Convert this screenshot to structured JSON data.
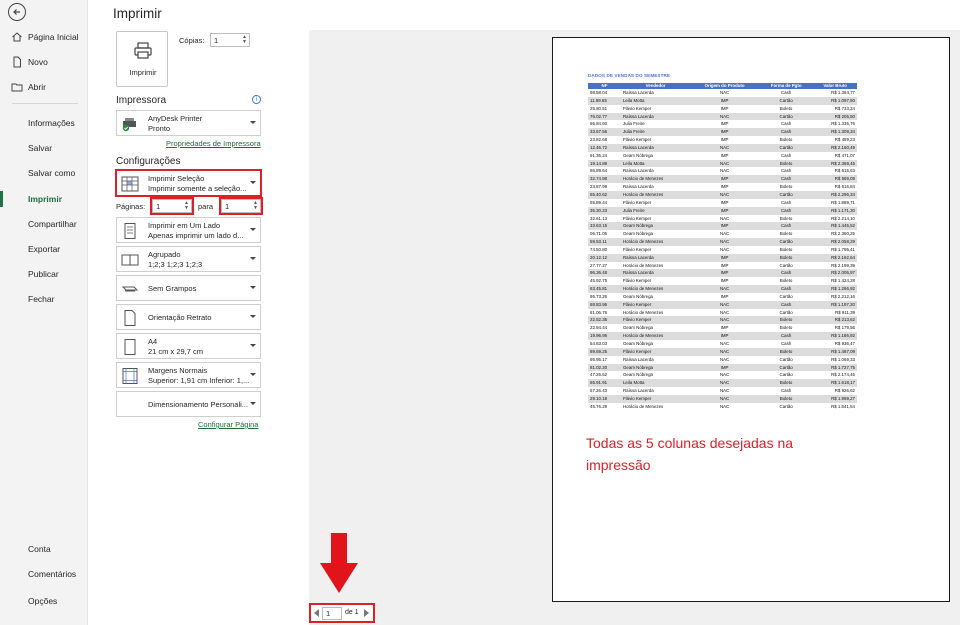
{
  "nav": {
    "items_top": [
      "Página Inicial",
      "Novo",
      "Abrir"
    ],
    "items_mid": [
      "Informações",
      "Salvar",
      "Salvar como",
      "Imprimir",
      "Compartilhar",
      "Exportar",
      "Publicar",
      "Fechar"
    ],
    "items_bottom": [
      "Conta",
      "Comentários",
      "Opções"
    ],
    "active": "Imprimir"
  },
  "print": {
    "title": "Imprimir",
    "print_button": "Imprimir",
    "copies_label": "Cópias:",
    "copies_value": "1"
  },
  "printer": {
    "section": "Impressora",
    "name": "AnyDesk Printer",
    "status": "Pronto",
    "properties_link": "Propriedades de Impressora"
  },
  "settings": {
    "section": "Configurações",
    "what": {
      "l1": "Imprimir Seleção",
      "l2": "Imprimir somente a seleção..."
    },
    "pages_label": "Páginas:",
    "pages_from": "1",
    "pages_to_label": "para",
    "pages_to": "1",
    "sides": {
      "l1": "Imprimir em Um Lado",
      "l2": "Apenas imprimir um lado d..."
    },
    "collate": {
      "l1": "Agrupado",
      "l2": "1;2;3    1;2;3    1;2;3"
    },
    "staple": "Sem Grampos",
    "orientation": "Orientação Retrato",
    "paper": {
      "l1": "A4",
      "l2": "21 cm x 29,7 cm"
    },
    "margins": {
      "l1": "Margens Normais",
      "l2": "Superior: 1,91 cm Inferior: 1,..."
    },
    "scaling": "Dimensionamento Personali...",
    "page_setup_link": "Configurar Página"
  },
  "preview": {
    "sheet_title": "DADOS DE VENDAS DO SEMESTRE",
    "columns": [
      "NF",
      "Vendedor",
      "Origem do Produto",
      "Forma de Pgto",
      "Valor Bruto"
    ],
    "rows": [
      [
        "98.58.04",
        "Raíssa Lacerda",
        "NAC",
        "Cash",
        "R$ 1.364,77"
      ],
      [
        "11.99.65",
        "Leila Motta",
        "IMP",
        "Cartão",
        "R$ 1.097,50"
      ],
      [
        "25.80.51",
        "Flávio Kemper",
        "IMP",
        "Boleto",
        "R$ 733,24"
      ],
      [
        "76.02.77",
        "Raíssa Lacerda",
        "NAC",
        "Cartão",
        "R$ 205,50"
      ],
      [
        "95.84.60",
        "Julia Freire",
        "IMP",
        "Cash",
        "R$ 1.335,76"
      ],
      [
        "33.67.56",
        "Julia Freire",
        "IMP",
        "Cash",
        "R$ 1.309,34"
      ],
      [
        "23.82.68",
        "Flávio Kemper",
        "IMP",
        "Boleto",
        "R$ 459,23"
      ],
      [
        "12.46.72",
        "Raíssa Lacerda",
        "NAC",
        "Cartão",
        "R$ 2.160,49"
      ],
      [
        "91.35.24",
        "Geam Nóbrega",
        "IMP",
        "Cash",
        "R$ 471,07"
      ],
      [
        "19.14.89",
        "Leila Motta",
        "NAC",
        "Boleto",
        "R$ 2.369,45"
      ],
      [
        "86.89.64",
        "Raíssa Lacerda",
        "NAC",
        "Cash",
        "R$ 615,63"
      ],
      [
        "32.74.98",
        "Horácio de Menezes",
        "IMP",
        "Cash",
        "R$ 569,09"
      ],
      [
        "23.87.99",
        "Raíssa Lacerda",
        "IMP",
        "Boleto",
        "R$ 616,84"
      ],
      [
        "65.40.62",
        "Horácio de Menezes",
        "NAC",
        "Cartão",
        "R$ 2.296,34"
      ],
      [
        "55.89.44",
        "Flávio Kemper",
        "IMP",
        "Cash",
        "R$ 1.889,71"
      ],
      [
        "35.30.23",
        "Julia Freire",
        "IMP",
        "Cash",
        "R$ 1.171,30"
      ],
      [
        "32.61.13",
        "Flávio Kemper",
        "NAC",
        "Boleto",
        "R$ 2.214,10"
      ],
      [
        "33.63.15",
        "Geam Nóbrega",
        "IMP",
        "Cash",
        "R$ 1.445,52"
      ],
      [
        "06.71.05",
        "Geam Nóbrega",
        "NAC",
        "Boleto",
        "R$ 2.360,25"
      ],
      [
        "59.53.11",
        "Horácio de Menezes",
        "NAC",
        "Cartão",
        "R$ 2.058,29"
      ],
      [
        "74.50.80",
        "Flávio Kemper",
        "NAC",
        "Boleto",
        "R$ 1.795,41"
      ],
      [
        "20.12.12",
        "Raíssa Lacerda",
        "IMP",
        "Boleto",
        "R$ 2.162,64"
      ],
      [
        "27.77.27",
        "Horácio de Menezes",
        "IMP",
        "Cartão",
        "R$ 2.199,39"
      ],
      [
        "96.36.48",
        "Raíssa Lacerda",
        "IMP",
        "Cash",
        "R$ 2.006,97"
      ],
      [
        "45.92.75",
        "Flávio Kemper",
        "IMP",
        "Boleto",
        "R$ 1.424,28"
      ],
      [
        "63.45.81",
        "Horácio de Menezes",
        "NAC",
        "Cash",
        "R$ 1.266,92"
      ],
      [
        "95.73.26",
        "Geam Nóbrega",
        "IMP",
        "Cartão",
        "R$ 2.212,16"
      ],
      [
        "88.83.96",
        "Flávio Kemper",
        "NAC",
        "Cash",
        "R$ 1.197,20"
      ],
      [
        "81.06.76",
        "Horácio de Menezes",
        "NAC",
        "Cartão",
        "R$ 911,39"
      ],
      [
        "22.52.35",
        "Flávio Kemper",
        "NAC",
        "Boleto",
        "R$ 213,62"
      ],
      [
        "22.94.44",
        "Geam Nóbrega",
        "IMP",
        "Boleto",
        "R$ 179,56"
      ],
      [
        "19.96.95",
        "Horácio de Menezes",
        "IMP",
        "Cash",
        "R$ 1.186,92"
      ],
      [
        "54.83.03",
        "Geam Nóbrega",
        "NAC",
        "Cash",
        "R$ 936,47"
      ],
      [
        "89.69.25",
        "Flávio Kemper",
        "NAC",
        "Boleto",
        "R$ 1.467,09"
      ],
      [
        "95.95.17",
        "Raíssa Lacerda",
        "NAC",
        "Cartão",
        "R$ 1.069,33"
      ],
      [
        "81.02.20",
        "Geam Nóbrega",
        "IMP",
        "Cartão",
        "R$ 1.727,75"
      ],
      [
        "47.26.52",
        "Geam Nóbrega",
        "NAC",
        "Cartão",
        "R$ 2.174,45"
      ],
      [
        "65.91.91",
        "Leila Motta",
        "NAC",
        "Boleto",
        "R$ 1.618,17"
      ],
      [
        "57.26.43",
        "Raíssa Lacerda",
        "NAC",
        "Cash",
        "R$ 926,62"
      ],
      [
        "29.10.18",
        "Flávio Kemper",
        "NAC",
        "Boleto",
        "R$ 1.969,27"
      ],
      [
        "45.76.29",
        "Horácio de Menezes",
        "NAC",
        "Cartão",
        "R$ 1.541,54"
      ]
    ],
    "annotation": "Todas as 5 colunas desejadas na impressão"
  },
  "page_nav": {
    "current": "1",
    "of_label": "de 1"
  },
  "colors": {
    "accent": "#217346",
    "highlight": "#d9212a",
    "table_header": "#4472c4"
  }
}
